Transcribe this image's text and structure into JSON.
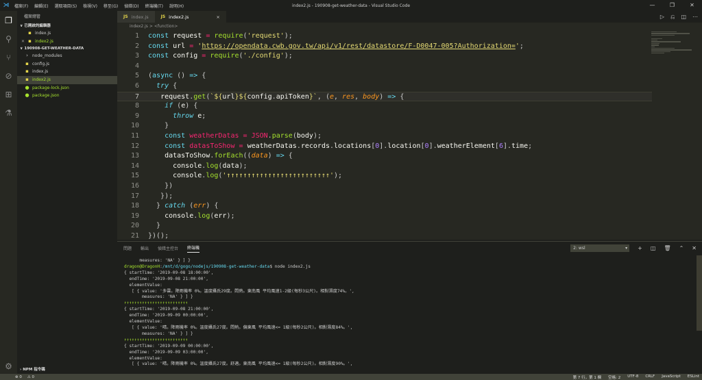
{
  "window": {
    "title": "index2.js - 190908-get-weather-data - Visual Studio Code",
    "menu": [
      "檔案(F)",
      "編輯(E)",
      "選取項目(S)",
      "檢視(V)",
      "移至(G)",
      "偵錯(D)",
      "終端機(T)",
      "說明(H)"
    ]
  },
  "sidebar": {
    "header": "檔案總管",
    "open_editors_title": "已開啟的編輯器",
    "open_editors": [
      {
        "label": "index.js"
      },
      {
        "label": "index2.js"
      }
    ],
    "folder_title": "190908-GET-WEATHER-DATA",
    "files": [
      {
        "label": "node_modules",
        "type": "folder"
      },
      {
        "label": "config.js",
        "type": "js"
      },
      {
        "label": "index.js",
        "type": "js"
      },
      {
        "label": "index2.js",
        "type": "js"
      },
      {
        "label": "package-lock.json",
        "type": "json"
      },
      {
        "label": "package.json",
        "type": "json"
      }
    ],
    "npm_title": "NPM 指令碼"
  },
  "tabs": [
    {
      "label": "index.js",
      "active": false
    },
    {
      "label": "index2.js",
      "active": true
    }
  ],
  "breadcrumb": {
    "file": "index2.js",
    "sep": ">",
    "symbol": "<function>"
  },
  "editor": {
    "lines": [
      {
        "n": "1",
        "html": "<span class='kw'>const</span> <span class='var'>request</span> <span class='op'>=</span> <span class='fn'>require</span>(<span class='str'>'request'</span>);"
      },
      {
        "n": "2",
        "html": "<span class='kw'>const</span> <span class='var'>url</span> <span class='op'>=</span> <span class='str'>'</span><span class='url'>https://opendata.cwb.gov.tw/api/v1/rest/datastore/F-D0047-005?Authorization=</span><span class='str'>'</span>;"
      },
      {
        "n": "3",
        "html": "<span class='kw'>const</span> <span class='var'>config</span> <span class='op'>=</span> <span class='fn'>require</span>(<span class='str'>'./config'</span>);"
      },
      {
        "n": "4",
        "html": ""
      },
      {
        "n": "5",
        "html": "(<span class='kw'>async</span> () <span class='kw'>=&gt;</span> {"
      },
      {
        "n": "6",
        "html": "  <span class='kwi'>try</span> {"
      },
      {
        "n": "7",
        "html": "   <span class='var'>request</span>.<span class='fn'>get</span>(<span class='str'>`${</span><span class='var'>url</span><span class='str'>}${</span><span class='var'>config</span>.<span class='var'>apiToken</span><span class='str'>}`</span>, (<span class='prm'>e</span>, <span class='prm'>res</span>, <span class='prm'>body</span>) <span class='kw'>=&gt;</span> {"
      },
      {
        "n": "8",
        "html": "    <span class='kwi'>if</span> (<span class='var'>e</span>) {"
      },
      {
        "n": "9",
        "html": "      <span class='kwi'>throw</span> <span class='var'>e</span>;"
      },
      {
        "n": "10",
        "html": "    }"
      },
      {
        "n": "11",
        "html": "    <span class='kw'>const</span> <span class='red'>weatherDatas</span> <span class='op'>=</span> <span class='red'>JSON</span>.<span class='fn'>parse</span>(<span class='var'>body</span>);"
      },
      {
        "n": "12",
        "html": "    <span class='kw'>const</span> <span class='red'>datasToShow</span> <span class='op'>=</span> <span class='var'>weatherDatas</span>.<span class='var'>records</span>.<span class='var'>locations</span>[<span class='num'>0</span>].<span class='var'>location</span>[<span class='num'>0</span>].<span class='var'>weatherElement</span>[<span class='num'>6</span>].<span class='var'>time</span>;"
      },
      {
        "n": "13",
        "html": "    <span class='var'>datasToShow</span>.<span class='fn'>forEach</span>((<span class='prm'>data</span>) <span class='kw'>=&gt;</span> {"
      },
      {
        "n": "14",
        "html": "      <span class='var'>console</span>.<span class='fn'>log</span>(<span class='var'>data</span>);"
      },
      {
        "n": "15",
        "html": "      <span class='var'>console</span>.<span class='fn'>log</span>(<span class='str'>'↑↑↑↑↑↑↑↑↑↑↑↑↑↑↑↑↑↑↑↑↑↑↑↑↑'</span>);"
      },
      {
        "n": "16",
        "html": "    })"
      },
      {
        "n": "17",
        "html": "   });"
      },
      {
        "n": "18",
        "html": "  } <span class='kwi'>catch</span> (<span class='prm'>err</span>) {"
      },
      {
        "n": "19",
        "html": "    <span class='var'>console</span>.<span class='fn'>log</span>(<span class='var'>err</span>);"
      },
      {
        "n": "20",
        "html": "  }"
      },
      {
        "n": "21",
        "html": "})();"
      }
    ],
    "current_line": "7"
  },
  "panel": {
    "tabs": [
      "問題",
      "輸出",
      "偵錯主控台",
      "終端機"
    ],
    "active_tab": "終端機",
    "terminal_select": "2: wsl",
    "terminal_lines": [
      {
        "t": "      measures: 'NA' } ] }"
      },
      {
        "t": "dragon@DragonH:/mnt/d/gogo/nodejs/190908-get-weather-data$ node index2.js",
        "prompt": true
      },
      {
        "t": "{ startTime: '2019-09-08 18:00:00',"
      },
      {
        "t": "  endTime: '2019-09-08 21:00:00',"
      },
      {
        "t": "  elementValue:"
      },
      {
        "t": "   [ { value: '多雲。降雨機率 0%。溫度攝氏29度。悶熱。東南風 平均風速1-2級(每秒3公尺)。相對濕度74%。',"
      },
      {
        "t": "       measures: 'NA' } ] }"
      },
      {
        "t": "↑↑↑↑↑↑↑↑↑↑↑↑↑↑↑↑↑↑↑↑↑↑↑↑↑"
      },
      {
        "t": "{ startTime: '2019-09-08 21:00:00',"
      },
      {
        "t": "  endTime: '2019-09-09 00:00:00',"
      },
      {
        "t": "  elementValue:"
      },
      {
        "t": "   [ { value: '晴。降雨機率 0%。溫度攝氏27度。悶熱。偏東風 平均風速<= 1級(每秒2公尺)。相對濕度84%。',"
      },
      {
        "t": "       measures: 'NA' } ] }"
      },
      {
        "t": "↑↑↑↑↑↑↑↑↑↑↑↑↑↑↑↑↑↑↑↑↑↑↑↑↑"
      },
      {
        "t": "{ startTime: '2019-09-09 00:00:00',"
      },
      {
        "t": "  endTime: '2019-09-09 03:00:00',"
      },
      {
        "t": "  elementValue:"
      },
      {
        "t": "   [ { value: '晴。降雨機率 0%。溫度攝氏27度。舒適。東南風 平均風速<= 1級(每秒2公尺)。相對濕度90%。',"
      }
    ]
  },
  "status": {
    "left": [
      "⊗ 0",
      "⚠ 0"
    ],
    "right": [
      "第 7 行，第 1 欄",
      "空格: 2",
      "UTF-8",
      "CRLF",
      "JavaScript",
      "ESLint"
    ]
  },
  "colors": {
    "bg": "#272822",
    "sidebar": "#1e1f1c",
    "status": "#414339"
  }
}
